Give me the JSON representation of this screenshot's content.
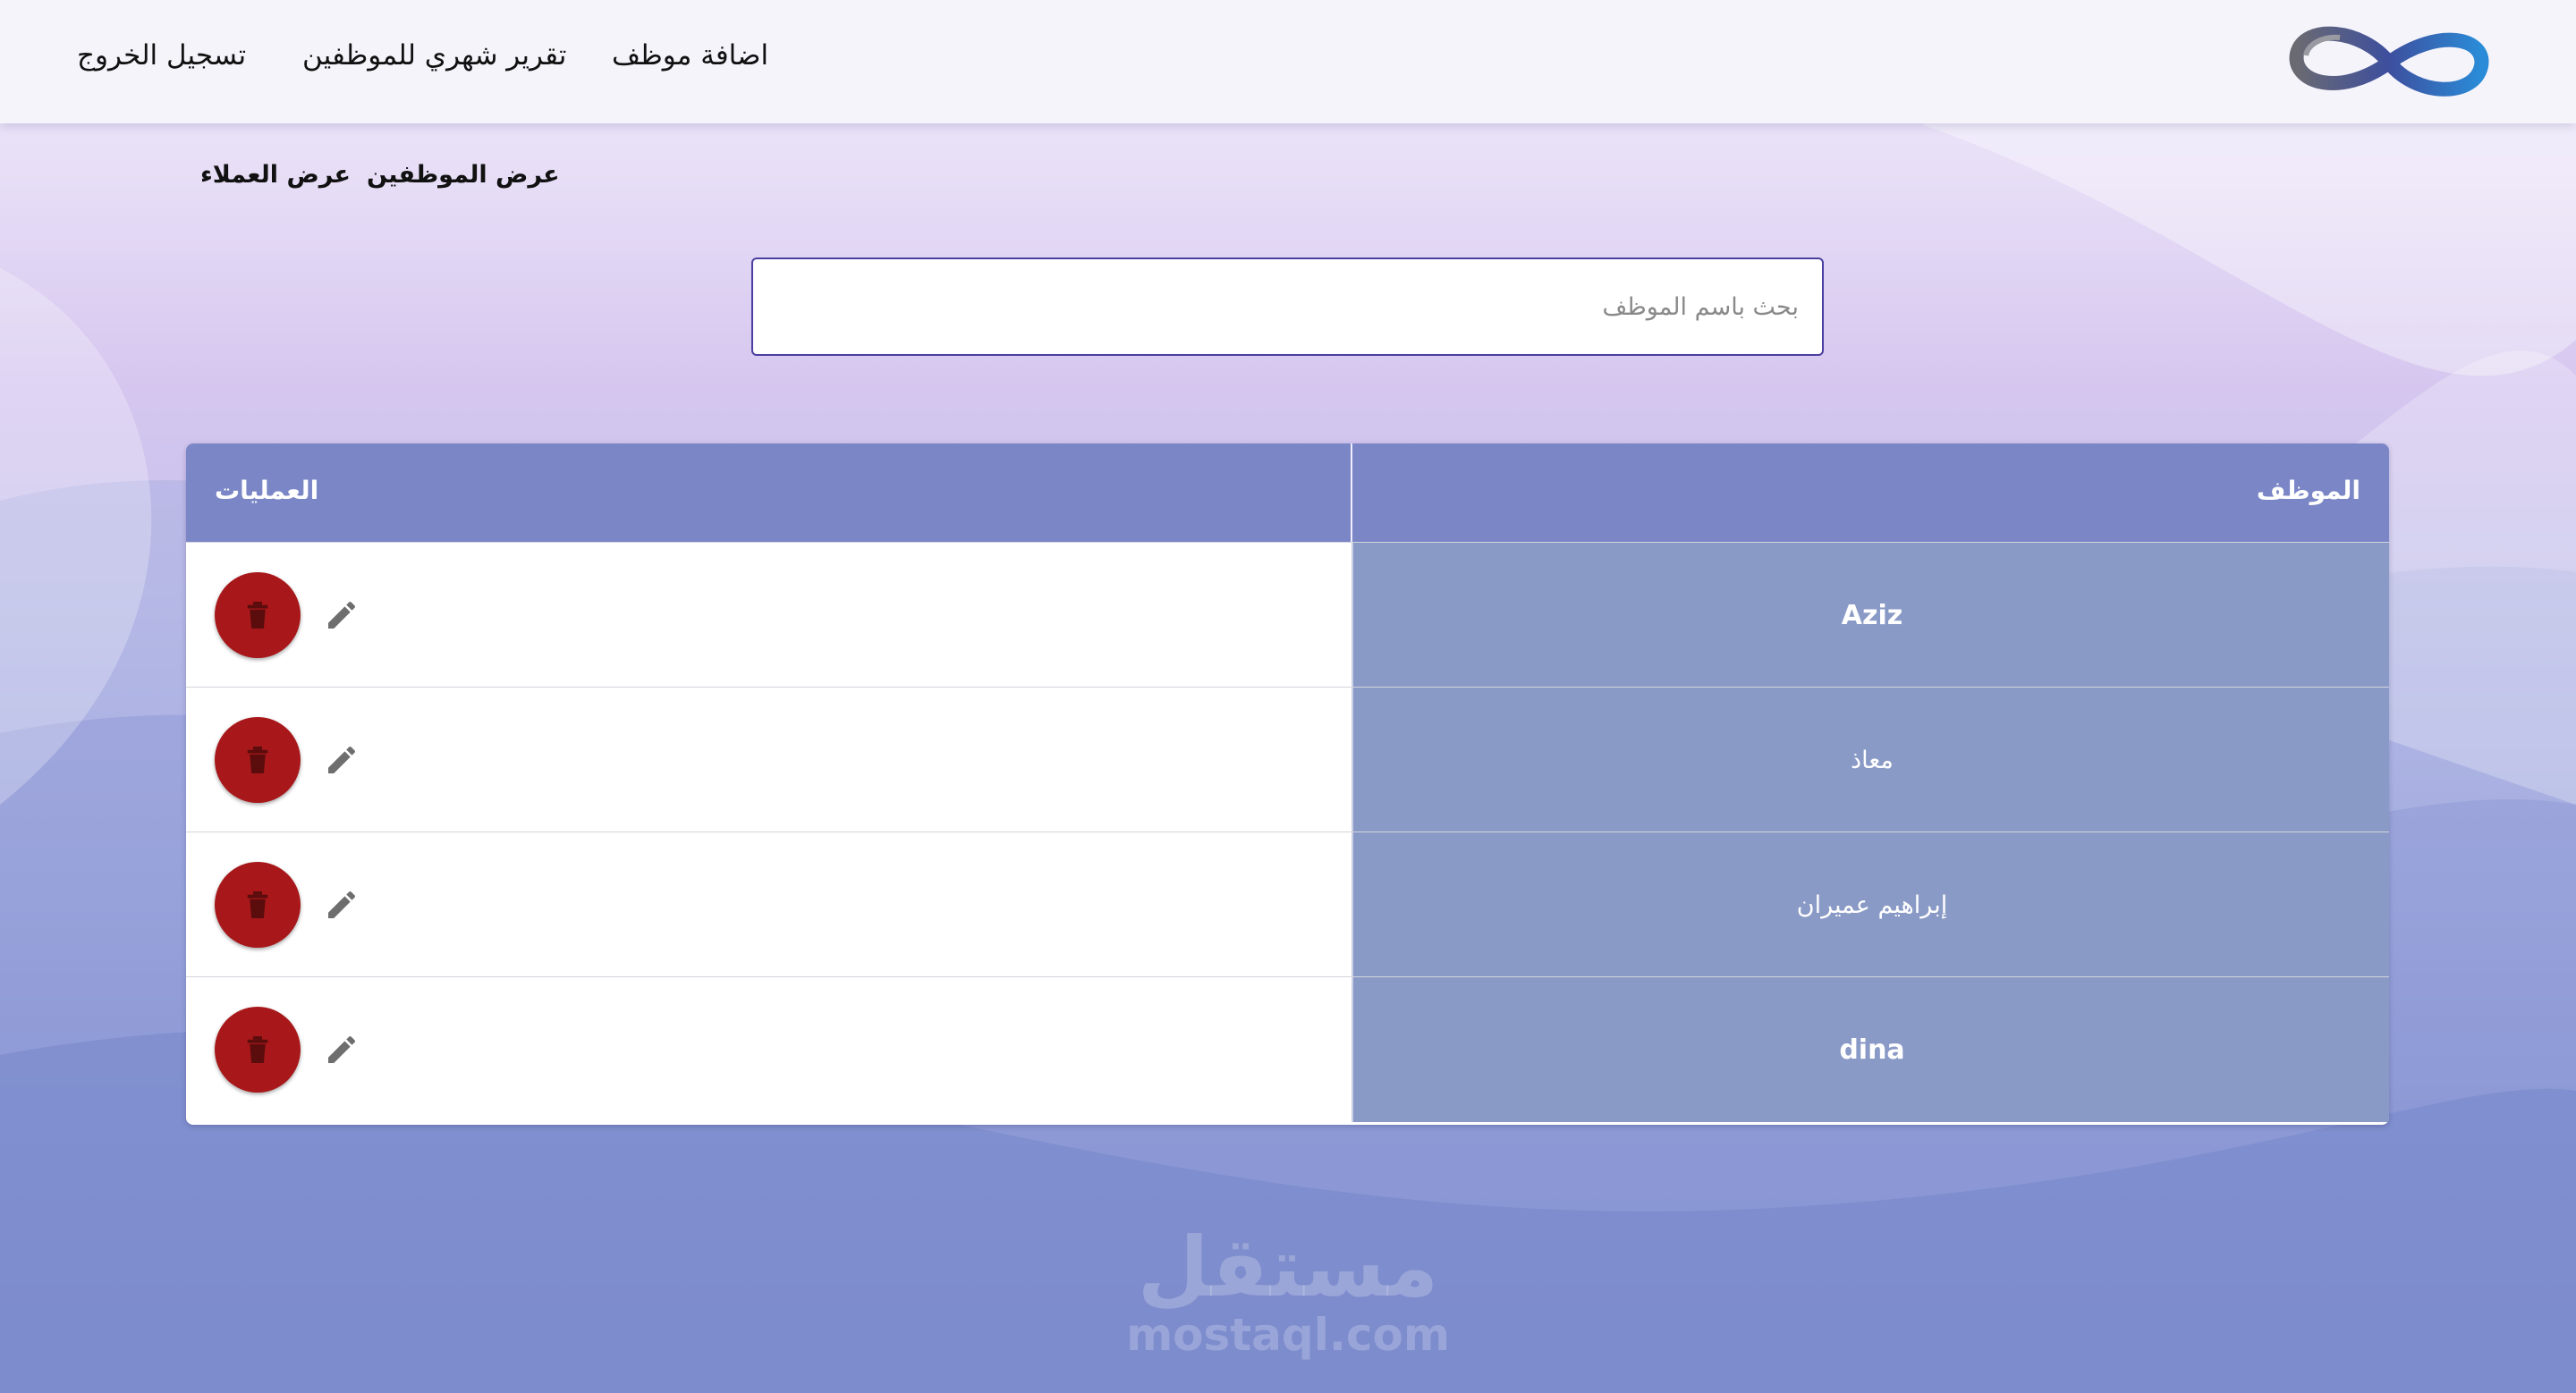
{
  "nav": {
    "add_employee": "اضافة موظف",
    "monthly_report": "تقرير شهري للموظفين",
    "logout": "تسجيل الخروج"
  },
  "subnav": {
    "employees": "عرض الموظفين",
    "clients": "عرض العملاء"
  },
  "search": {
    "placeholder": "بحث باسم الموظف",
    "value": ""
  },
  "table": {
    "headers": {
      "employee": "الموظف",
      "operations": "العمليات"
    },
    "rows": [
      {
        "name": "Aziz"
      },
      {
        "name": "معاذ"
      },
      {
        "name": "إبراهيم عميران"
      },
      {
        "name": "dina"
      }
    ]
  },
  "watermark": {
    "arabic": "مستقل",
    "latin": "mostaql.com"
  },
  "colors": {
    "header_bg": "#7a86c6",
    "name_cell_bg": "#8a9ac6",
    "delete_button": "#a8181a",
    "search_border": "#4a3fa0"
  },
  "icons": {
    "logo": "infinity-logo",
    "delete": "trash-icon",
    "edit": "pencil-icon"
  }
}
